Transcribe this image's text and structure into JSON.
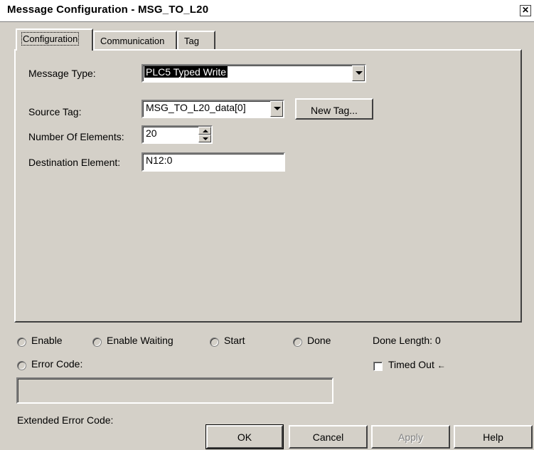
{
  "window": {
    "title": "Message Configuration - MSG_TO_L20"
  },
  "tabs": [
    {
      "label": "Configuration"
    },
    {
      "label": "Communication"
    },
    {
      "label": "Tag"
    }
  ],
  "config": {
    "message_type": {
      "label": "Message Type:",
      "value": "PLC5 Typed Write"
    },
    "source_tag": {
      "label": "Source Tag:",
      "value": "MSG_TO_L20_data[0]"
    },
    "new_tag_button": "New Tag...",
    "num_elements": {
      "label": "Number Of Elements:",
      "value": "20"
    },
    "destination": {
      "label": "Destination Element:",
      "value": "N12:0"
    }
  },
  "status": {
    "enable": "Enable",
    "enable_waiting": "Enable Waiting",
    "start": "Start",
    "done": "Done",
    "done_length": "Done Length: 0",
    "error_code": "Error Code:",
    "timed_out": "Timed Out",
    "extended_error_code": "Extended Error Code:",
    "error_text": ""
  },
  "buttons": {
    "ok": "OK",
    "cancel": "Cancel",
    "apply": "Apply",
    "help": "Help"
  }
}
